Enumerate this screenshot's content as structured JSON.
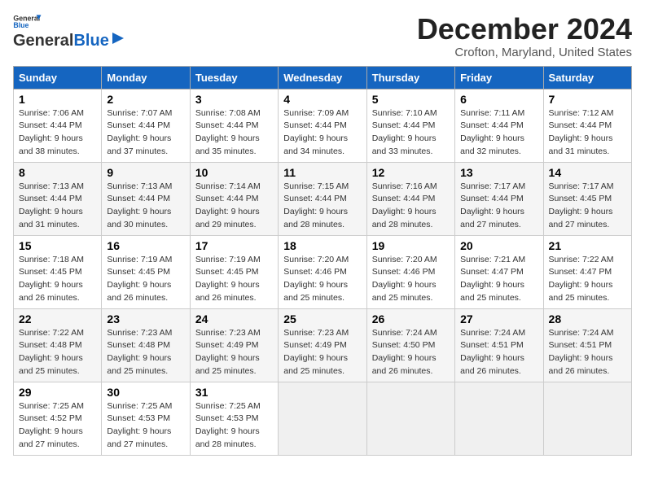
{
  "logo": {
    "line1": "General",
    "line2": "Blue"
  },
  "title": "December 2024",
  "location": "Crofton, Maryland, United States",
  "days_of_week": [
    "Sunday",
    "Monday",
    "Tuesday",
    "Wednesday",
    "Thursday",
    "Friday",
    "Saturday"
  ],
  "weeks": [
    [
      {
        "day": "1",
        "info": "Sunrise: 7:06 AM\nSunset: 4:44 PM\nDaylight: 9 hours\nand 38 minutes."
      },
      {
        "day": "2",
        "info": "Sunrise: 7:07 AM\nSunset: 4:44 PM\nDaylight: 9 hours\nand 37 minutes."
      },
      {
        "day": "3",
        "info": "Sunrise: 7:08 AM\nSunset: 4:44 PM\nDaylight: 9 hours\nand 35 minutes."
      },
      {
        "day": "4",
        "info": "Sunrise: 7:09 AM\nSunset: 4:44 PM\nDaylight: 9 hours\nand 34 minutes."
      },
      {
        "day": "5",
        "info": "Sunrise: 7:10 AM\nSunset: 4:44 PM\nDaylight: 9 hours\nand 33 minutes."
      },
      {
        "day": "6",
        "info": "Sunrise: 7:11 AM\nSunset: 4:44 PM\nDaylight: 9 hours\nand 32 minutes."
      },
      {
        "day": "7",
        "info": "Sunrise: 7:12 AM\nSunset: 4:44 PM\nDaylight: 9 hours\nand 31 minutes."
      }
    ],
    [
      {
        "day": "8",
        "info": "Sunrise: 7:13 AM\nSunset: 4:44 PM\nDaylight: 9 hours\nand 31 minutes."
      },
      {
        "day": "9",
        "info": "Sunrise: 7:13 AM\nSunset: 4:44 PM\nDaylight: 9 hours\nand 30 minutes."
      },
      {
        "day": "10",
        "info": "Sunrise: 7:14 AM\nSunset: 4:44 PM\nDaylight: 9 hours\nand 29 minutes."
      },
      {
        "day": "11",
        "info": "Sunrise: 7:15 AM\nSunset: 4:44 PM\nDaylight: 9 hours\nand 28 minutes."
      },
      {
        "day": "12",
        "info": "Sunrise: 7:16 AM\nSunset: 4:44 PM\nDaylight: 9 hours\nand 28 minutes."
      },
      {
        "day": "13",
        "info": "Sunrise: 7:17 AM\nSunset: 4:44 PM\nDaylight: 9 hours\nand 27 minutes."
      },
      {
        "day": "14",
        "info": "Sunrise: 7:17 AM\nSunset: 4:45 PM\nDaylight: 9 hours\nand 27 minutes."
      }
    ],
    [
      {
        "day": "15",
        "info": "Sunrise: 7:18 AM\nSunset: 4:45 PM\nDaylight: 9 hours\nand 26 minutes."
      },
      {
        "day": "16",
        "info": "Sunrise: 7:19 AM\nSunset: 4:45 PM\nDaylight: 9 hours\nand 26 minutes."
      },
      {
        "day": "17",
        "info": "Sunrise: 7:19 AM\nSunset: 4:45 PM\nDaylight: 9 hours\nand 26 minutes."
      },
      {
        "day": "18",
        "info": "Sunrise: 7:20 AM\nSunset: 4:46 PM\nDaylight: 9 hours\nand 25 minutes."
      },
      {
        "day": "19",
        "info": "Sunrise: 7:20 AM\nSunset: 4:46 PM\nDaylight: 9 hours\nand 25 minutes."
      },
      {
        "day": "20",
        "info": "Sunrise: 7:21 AM\nSunset: 4:47 PM\nDaylight: 9 hours\nand 25 minutes."
      },
      {
        "day": "21",
        "info": "Sunrise: 7:22 AM\nSunset: 4:47 PM\nDaylight: 9 hours\nand 25 minutes."
      }
    ],
    [
      {
        "day": "22",
        "info": "Sunrise: 7:22 AM\nSunset: 4:48 PM\nDaylight: 9 hours\nand 25 minutes."
      },
      {
        "day": "23",
        "info": "Sunrise: 7:23 AM\nSunset: 4:48 PM\nDaylight: 9 hours\nand 25 minutes."
      },
      {
        "day": "24",
        "info": "Sunrise: 7:23 AM\nSunset: 4:49 PM\nDaylight: 9 hours\nand 25 minutes."
      },
      {
        "day": "25",
        "info": "Sunrise: 7:23 AM\nSunset: 4:49 PM\nDaylight: 9 hours\nand 25 minutes."
      },
      {
        "day": "26",
        "info": "Sunrise: 7:24 AM\nSunset: 4:50 PM\nDaylight: 9 hours\nand 26 minutes."
      },
      {
        "day": "27",
        "info": "Sunrise: 7:24 AM\nSunset: 4:51 PM\nDaylight: 9 hours\nand 26 minutes."
      },
      {
        "day": "28",
        "info": "Sunrise: 7:24 AM\nSunset: 4:51 PM\nDaylight: 9 hours\nand 26 minutes."
      }
    ],
    [
      {
        "day": "29",
        "info": "Sunrise: 7:25 AM\nSunset: 4:52 PM\nDaylight: 9 hours\nand 27 minutes."
      },
      {
        "day": "30",
        "info": "Sunrise: 7:25 AM\nSunset: 4:53 PM\nDaylight: 9 hours\nand 27 minutes."
      },
      {
        "day": "31",
        "info": "Sunrise: 7:25 AM\nSunset: 4:53 PM\nDaylight: 9 hours\nand 28 minutes."
      },
      {
        "day": "",
        "info": ""
      },
      {
        "day": "",
        "info": ""
      },
      {
        "day": "",
        "info": ""
      },
      {
        "day": "",
        "info": ""
      }
    ]
  ]
}
